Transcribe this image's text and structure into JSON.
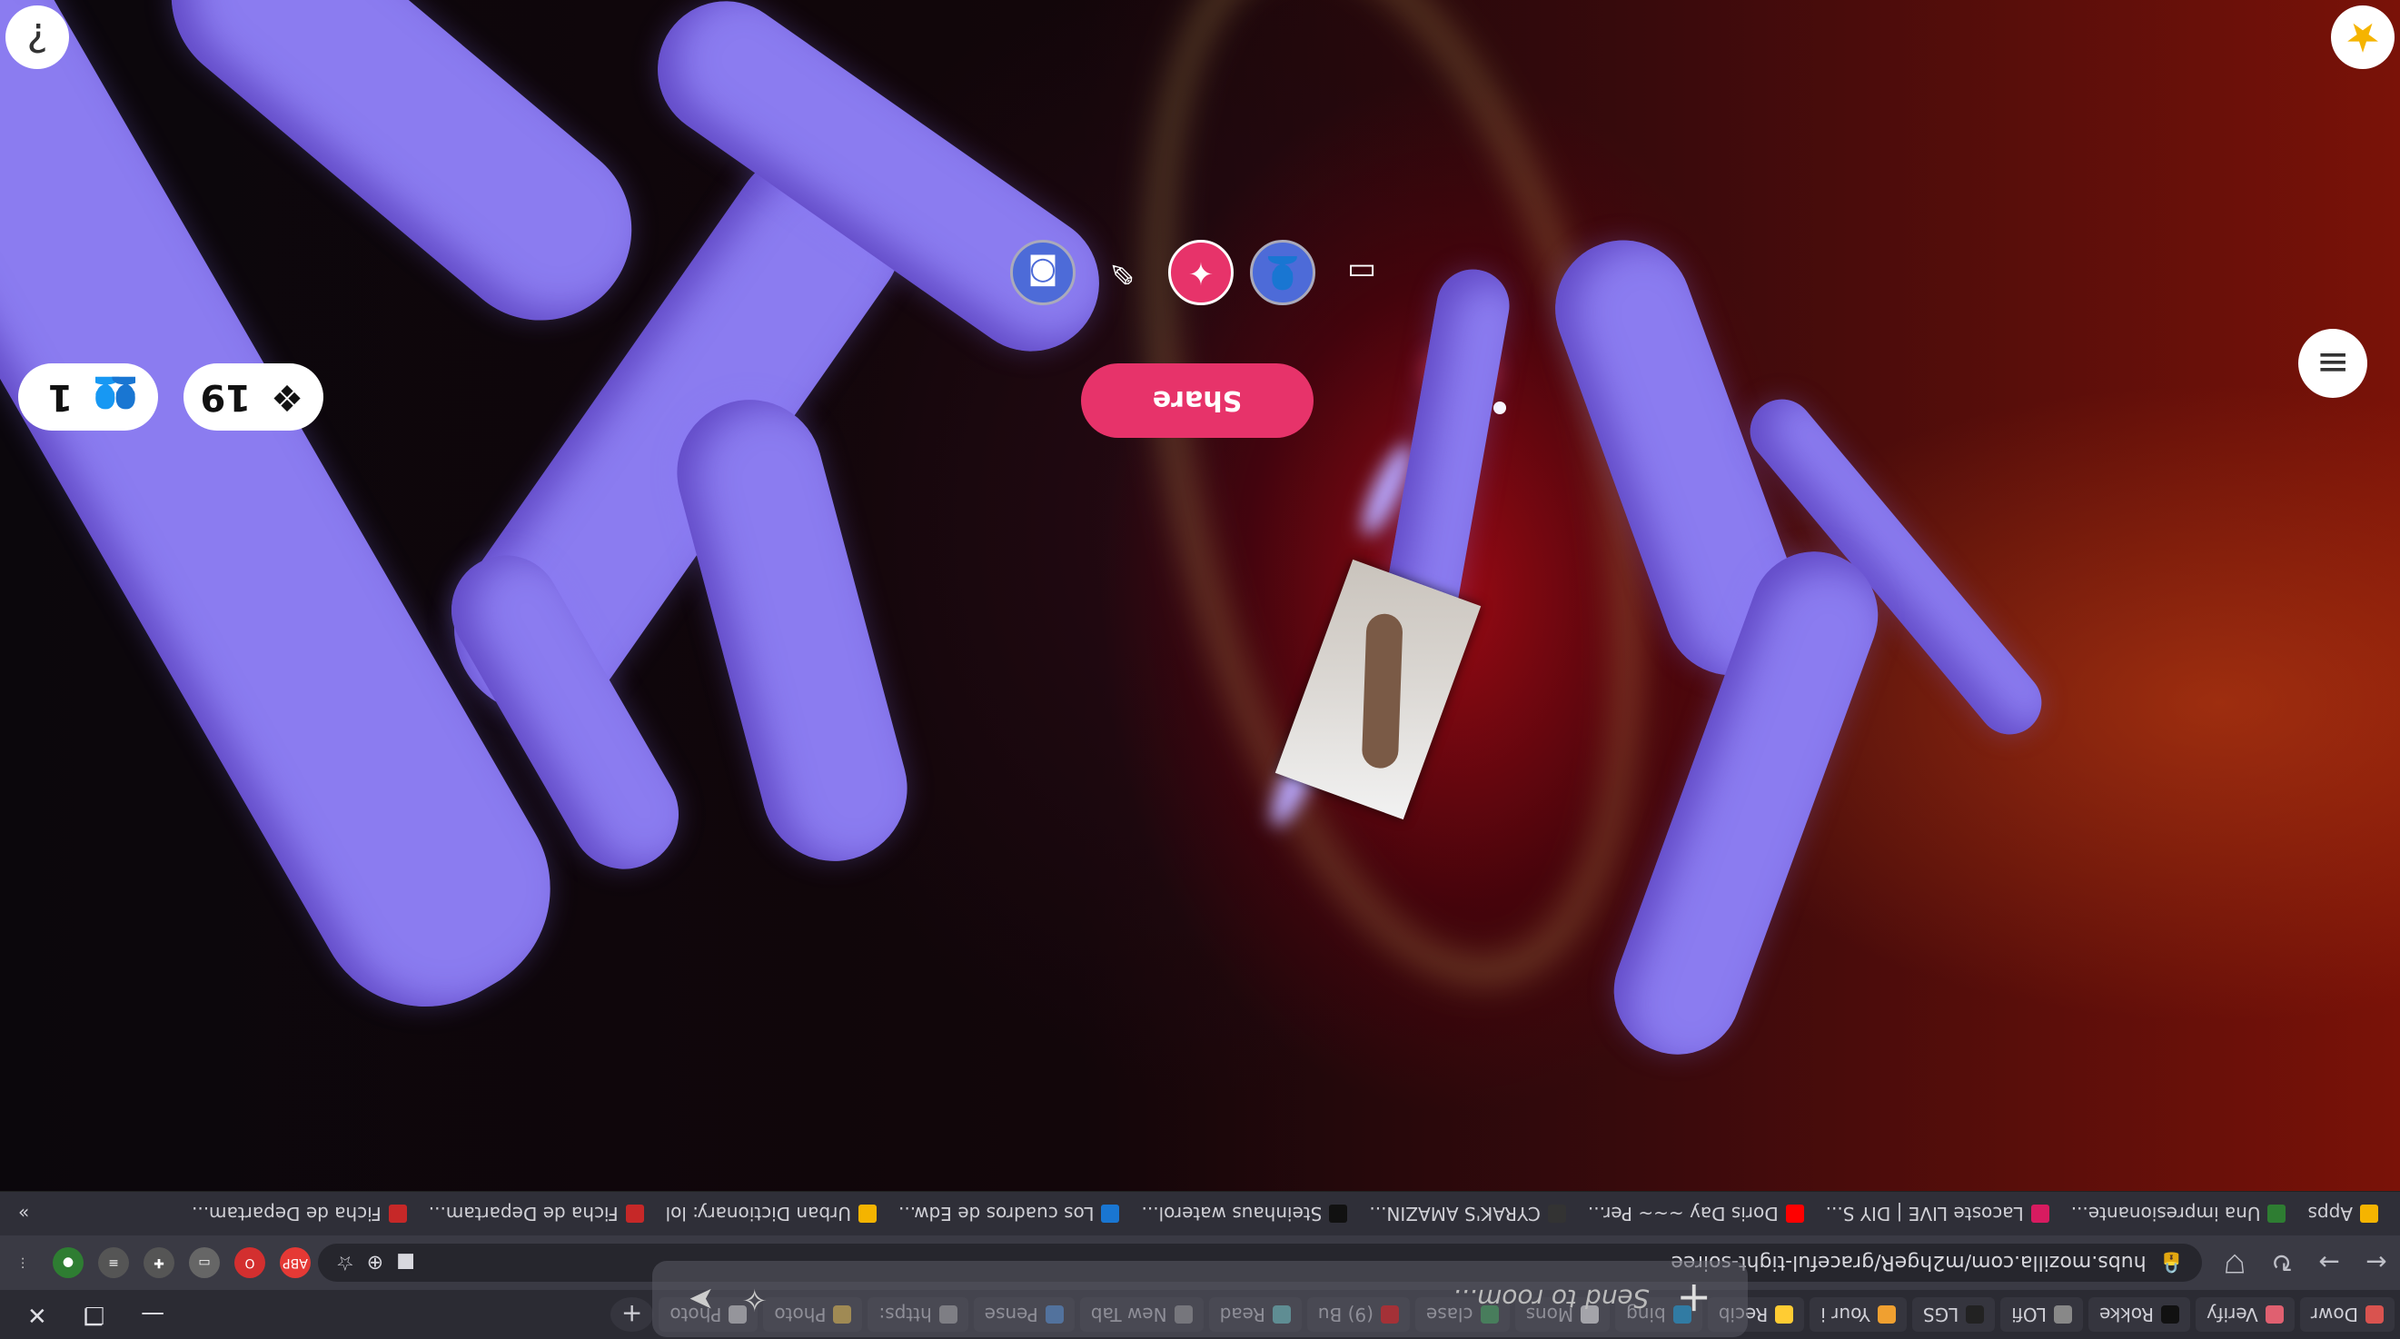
{
  "browser": {
    "tabs": [
      {
        "label": "Dowr",
        "color": "#d9534f"
      },
      {
        "label": "Verify",
        "color": "#e06070"
      },
      {
        "label": "Rokke",
        "color": "#111111"
      },
      {
        "label": "LOfi",
        "color": "#888888"
      },
      {
        "label": "LGS",
        "color": "#222222"
      },
      {
        "label": "Your i",
        "color": "#f0a030"
      },
      {
        "label": "Recib",
        "color": "#ffcc33"
      },
      {
        "label": "bing",
        "color": "#00a4ef"
      },
      {
        "label": "Mons",
        "color": "#ffffff"
      },
      {
        "label": "clase",
        "color": "#34a853"
      },
      {
        "label": "(9) Bu",
        "color": "#ff0000"
      },
      {
        "label": "Read",
        "color": "#6cc"
      },
      {
        "label": "New Tab",
        "color": "#999999"
      },
      {
        "label": "Pense",
        "color": "#4a90e2"
      },
      {
        "label": "https:",
        "color": "#aaaaaa"
      },
      {
        "label": "Photo",
        "color": "#f5c542"
      },
      {
        "label": "Photo",
        "color": "#dddddd"
      }
    ],
    "url": "hubs.mozilla.com/m2hgeR/graceful-tight-soiree",
    "bookmarks": [
      {
        "label": "Apps",
        "color": "#f5b400"
      },
      {
        "label": "Una impresionante...",
        "color": "#2e7d32"
      },
      {
        "label": "Lacoste LIVE | DIY S...",
        "color": "#d81b60"
      },
      {
        "label": "Doris Day ~~~ Per...",
        "color": "#ff0000"
      },
      {
        "label": "CYRAK'S AMAZIN...",
        "color": "#333333"
      },
      {
        "label": "Steinhaus waterol...",
        "color": "#111111"
      },
      {
        "label": "Los cuadros de Edw...",
        "color": "#1976d2"
      },
      {
        "label": "Urban Dictionary: lol",
        "color": "#f4b400"
      },
      {
        "label": "Ficha de Departam...",
        "color": "#c62828"
      },
      {
        "label": "Ficha de Departam...",
        "color": "#c62828"
      }
    ],
    "bookmarks_more": "»"
  },
  "hubs": {
    "chat_placeholder": "Send to room...",
    "share_label": "Share",
    "objects_count": "19",
    "people_count": "1",
    "help_glyph": "?",
    "favorite_glyph": "★",
    "menu_glyph": "≡"
  }
}
